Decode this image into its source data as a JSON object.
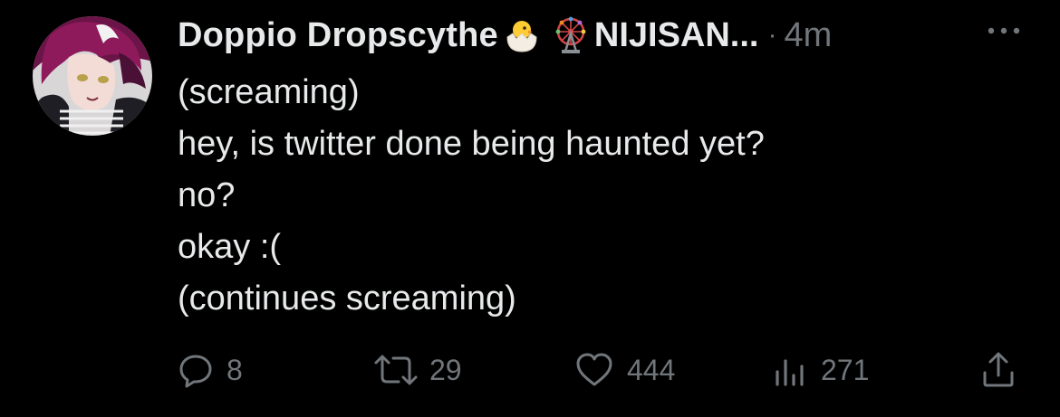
{
  "tweet": {
    "author": {
      "display_name": "Doppio Dropscythe",
      "org_truncated": "NIJISAN...",
      "emoji_1": "hatching-chick",
      "emoji_2": "ferris-wheel"
    },
    "separator": "·",
    "timestamp": "4m",
    "more_icon": "more-horizontal-icon",
    "lines": [
      "(screaming)",
      "hey, is twitter done being haunted yet?",
      "no?",
      "okay :(",
      "(continues screaming)"
    ],
    "actions": {
      "reply": {
        "icon": "reply-icon",
        "count": "8"
      },
      "retweet": {
        "icon": "retweet-icon",
        "count": "29"
      },
      "like": {
        "icon": "heart-icon",
        "count": "444"
      },
      "views": {
        "icon": "views-icon",
        "count": "271"
      },
      "share": {
        "icon": "share-icon"
      }
    }
  },
  "colors": {
    "background": "#000000",
    "text": "#e7e9ea",
    "secondary": "#71767b",
    "avatar_hair": "#8e1a5c",
    "avatar_accent": "#c2185b"
  }
}
